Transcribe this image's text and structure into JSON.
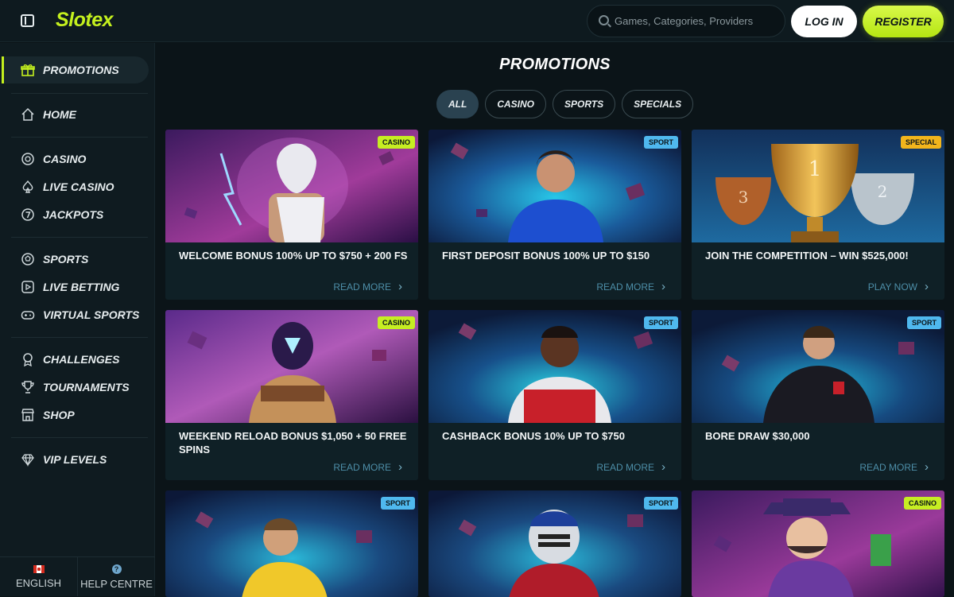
{
  "header": {
    "logo": "Slotex",
    "search_placeholder": "Games, Categories, Providers",
    "login_label": "LOG IN",
    "register_label": "REGISTER"
  },
  "sidebar": {
    "items": [
      {
        "label": "PROMOTIONS",
        "icon": "gift-icon",
        "active": true
      },
      {
        "label": "HOME",
        "icon": "home-icon"
      },
      {
        "label": "CASINO",
        "icon": "chip-icon"
      },
      {
        "label": "LIVE CASINO",
        "icon": "spade-icon"
      },
      {
        "label": "JACKPOTS",
        "icon": "seven-icon"
      },
      {
        "label": "SPORTS",
        "icon": "ball-icon"
      },
      {
        "label": "LIVE BETTING",
        "icon": "play-icon"
      },
      {
        "label": "VIRTUAL SPORTS",
        "icon": "gamepad-icon"
      },
      {
        "label": "CHALLENGES",
        "icon": "medal-icon"
      },
      {
        "label": "TOURNAMENTS",
        "icon": "trophy-icon"
      },
      {
        "label": "SHOP",
        "icon": "shop-icon"
      },
      {
        "label": "VIP LEVELS",
        "icon": "diamond-icon"
      }
    ],
    "footer": {
      "language": "ENGLISH",
      "help": "HELP CENTRE"
    }
  },
  "main": {
    "title": "PROMOTIONS",
    "filters": [
      "ALL",
      "CASINO",
      "SPORTS",
      "SPECIALS"
    ],
    "active_filter": "ALL",
    "promos": [
      {
        "badge": "CASINO",
        "title": "WELCOME BONUS 100% UP TO $750 + 200 FS",
        "link": "READ MORE",
        "art": "wizard"
      },
      {
        "badge": "SPORT",
        "title": "FIRST DEPOSIT BONUS 100% UP TO $150",
        "link": "READ MORE",
        "art": "player-blue"
      },
      {
        "badge": "SPECIAL",
        "title": "JOIN THE COMPETITION – WIN $525,000!",
        "link": "PLAY NOW",
        "art": "trophies"
      },
      {
        "badge": "CASINO",
        "title": "WEEKEND RELOAD BONUS $1,050 + 50 FREE SPINS",
        "link": "READ MORE",
        "art": "warrior"
      },
      {
        "badge": "SPORT",
        "title": "CASHBACK BONUS 10% UP TO $750",
        "link": "READ MORE",
        "art": "player-red"
      },
      {
        "badge": "SPORT",
        "title": "BORE DRAW $30,000",
        "link": "READ MORE",
        "art": "player-dark"
      },
      {
        "badge": "SPORT",
        "title": "",
        "link": "",
        "art": "basketball"
      },
      {
        "badge": "SPORT",
        "title": "",
        "link": "",
        "art": "football"
      },
      {
        "badge": "CASINO",
        "title": "",
        "link": "",
        "art": "gangster"
      }
    ]
  }
}
